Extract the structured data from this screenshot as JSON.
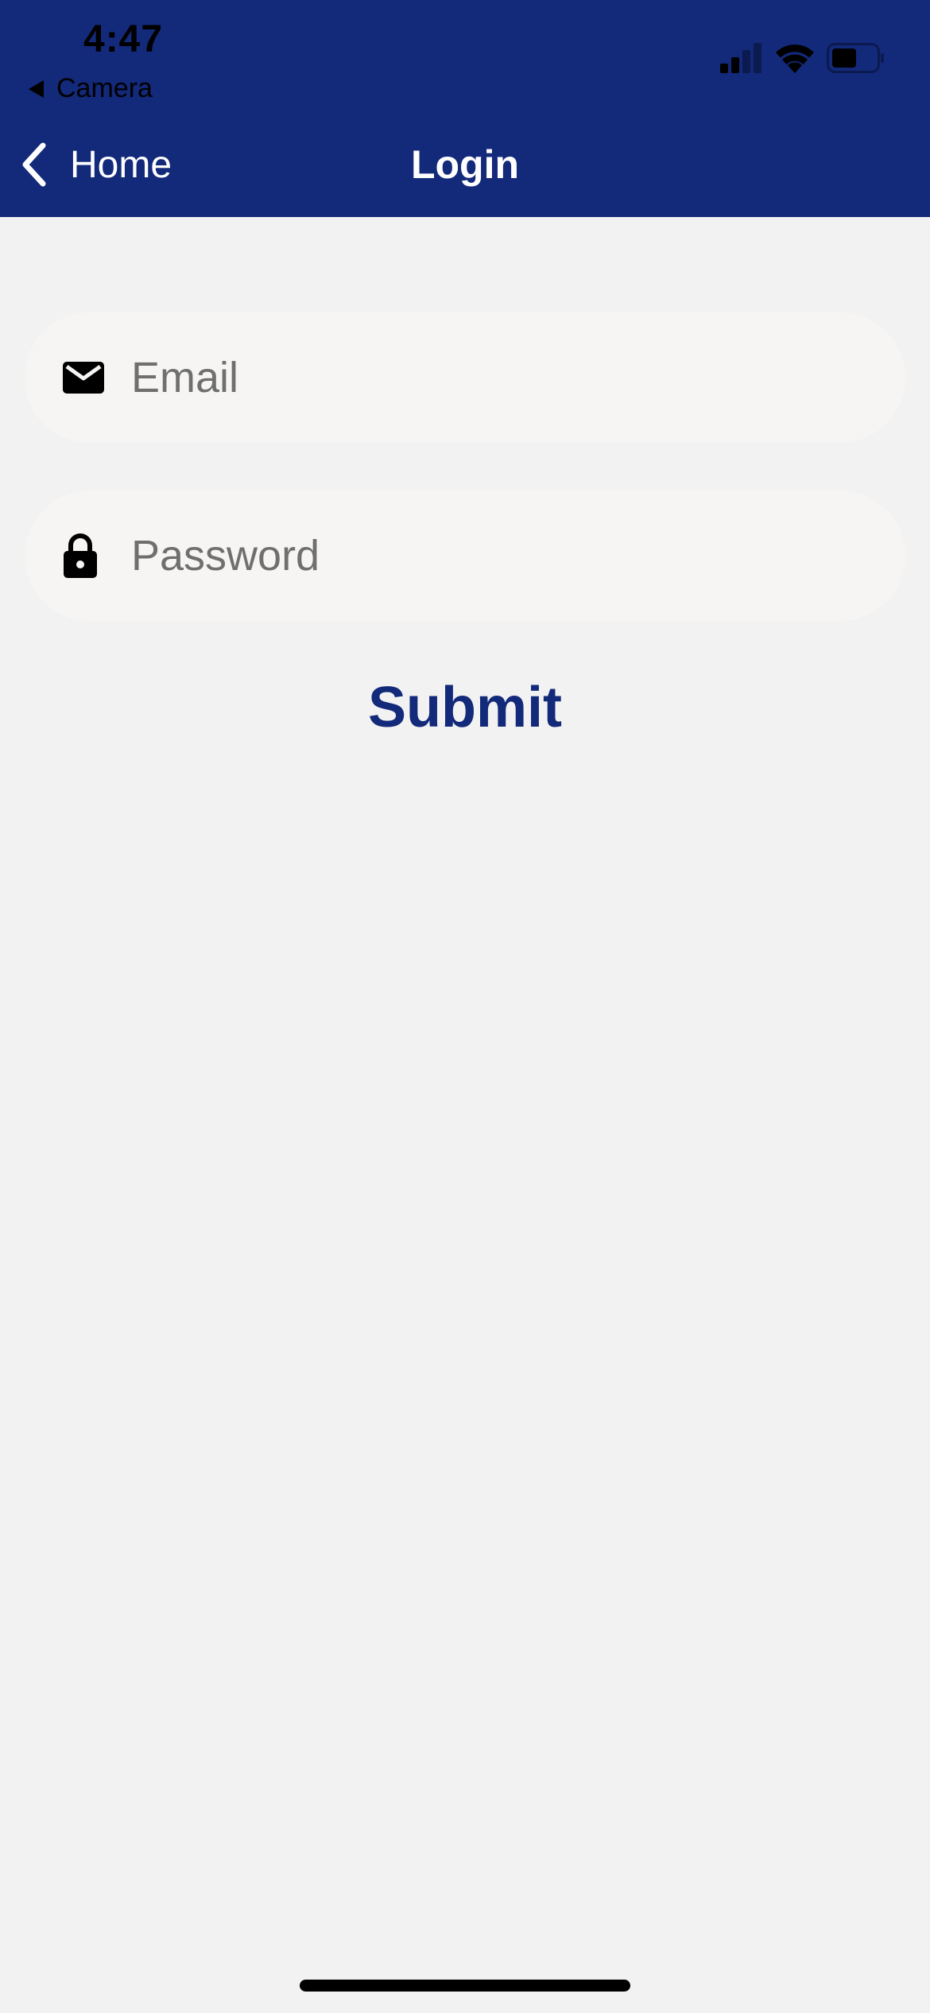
{
  "status_bar": {
    "time": "4:47",
    "back_app": "Camera",
    "icons": [
      "cellular-signal-icon",
      "wifi-icon",
      "battery-icon"
    ]
  },
  "nav": {
    "back_label": "Home",
    "title": "Login"
  },
  "form": {
    "email": {
      "placeholder": "Email",
      "value": "",
      "icon": "envelope-icon"
    },
    "password": {
      "placeholder": "Password",
      "value": "",
      "icon": "lock-icon"
    },
    "submit_label": "Submit"
  },
  "colors": {
    "header": "#13297a",
    "background": "#f2f2f2",
    "field": "#f6f5f4",
    "accent": "#13297a"
  }
}
